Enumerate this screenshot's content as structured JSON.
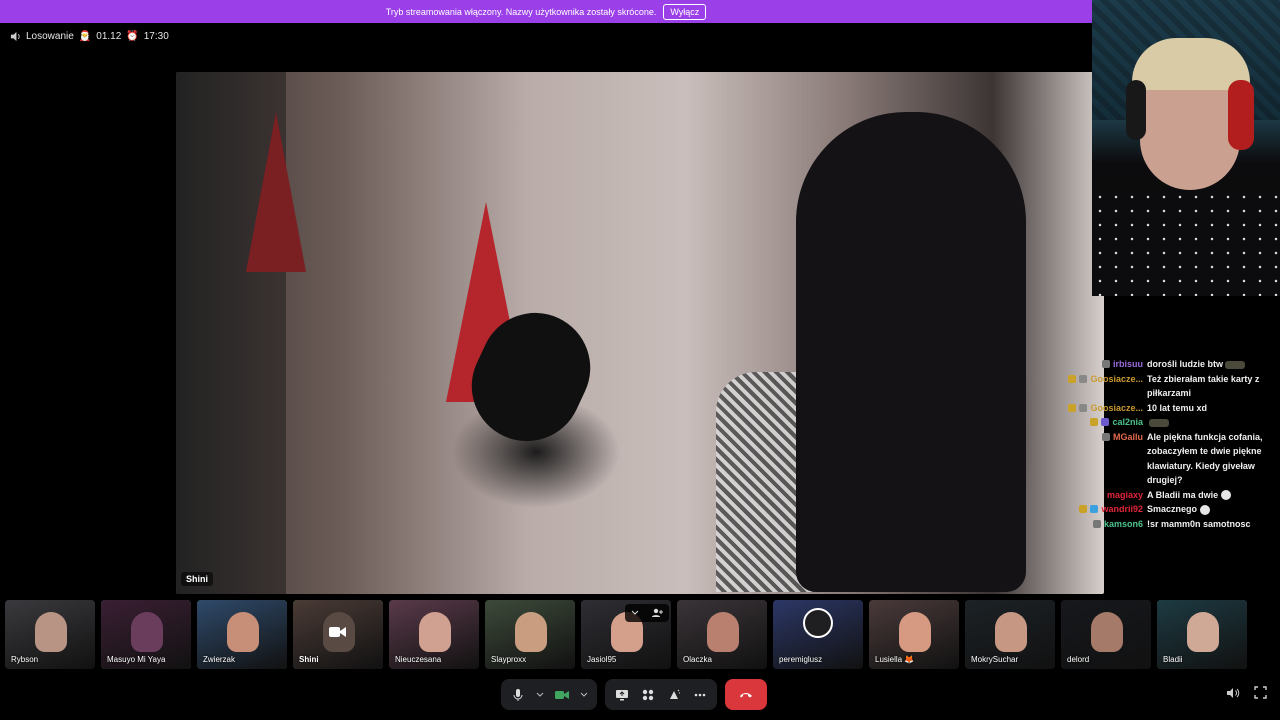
{
  "banner": {
    "message": "Tryb streamowania włączony. Nazwy użytkownika zostały skrócone.",
    "button": "Wyłącz"
  },
  "event": {
    "title": "Losowanie",
    "date_emoji": "🎅",
    "date": "01.12",
    "time_emoji": "⏰",
    "time": "17:30"
  },
  "stage": {
    "label": "Shini"
  },
  "chat": {
    "messages": [
      {
        "user": "irbisuu",
        "user_color": "#9b6bdc",
        "text": "dorośli ludzie btw",
        "emote": true,
        "badges": [
          "#777"
        ]
      },
      {
        "user": "Goosiacze...",
        "user_color": "#c99a2e",
        "text": "Też zbierałam takie karty z piłkarzami",
        "emote": false,
        "badges": [
          "#c9a227",
          "#888"
        ]
      },
      {
        "user": "Goosiacze...",
        "user_color": "#c99a2e",
        "text": "10 lat temu xd",
        "emote": false,
        "badges": [
          "#c9a227",
          "#888"
        ]
      },
      {
        "user": "cal2nia",
        "user_color": "#4cc28b",
        "text": "",
        "emote": true,
        "badges": [
          "#c9a227",
          "#6a5acd"
        ]
      },
      {
        "user": "MGallu",
        "user_color": "#e06a4c",
        "text": "Ale piękna funkcja cofania, zobaczyłem te dwie piękne klawiatury. Kiedy giveław drugiej?",
        "emote": false,
        "badges": [
          "#777"
        ]
      },
      {
        "user": "magiaxy",
        "user_color": "#e0263a",
        "text": "A Bladii ma dwie",
        "emote": false,
        "face": true,
        "badges": []
      },
      {
        "user": "wandrii92",
        "user_color": "#e0263a",
        "text": "Smacznego",
        "emote": false,
        "face": true,
        "badges": [
          "#c9a227",
          "#3aa0e0"
        ]
      },
      {
        "user": "kamson6",
        "user_color": "#4cc28b",
        "text": "!sr mamm0n samotnosc",
        "emote": false,
        "badges": [
          "#777"
        ]
      }
    ]
  },
  "participants": [
    {
      "name": "Rybson",
      "bg": "#3a3a3e",
      "skin": "#b89484",
      "speaking": false
    },
    {
      "name": "Masuyo Mi Yaya",
      "bg": "#3a1f33",
      "skin": "#6b3d5d",
      "speaking": true
    },
    {
      "name": "Zwierzak",
      "bg": "#2f4a6a",
      "skin": "#c78f78",
      "speaking": true
    },
    {
      "name": "Shini",
      "bg": "#4a3b36",
      "skin": "#5a4a44",
      "speaking": true,
      "camera_icon": true
    },
    {
      "name": "Nieuczesana",
      "bg": "#5a3a4a",
      "skin": "#d0a090",
      "speaking": false
    },
    {
      "name": "Slayproxx",
      "bg": "#3d4a3a",
      "skin": "#c89d80",
      "speaking": false
    },
    {
      "name": "Jasiol95",
      "bg": "#2e2e34",
      "skin": "#d4a08c",
      "speaking": false,
      "popout": true
    },
    {
      "name": "Olaczka",
      "bg": "#3a3438",
      "skin": "#b98070",
      "speaking": false
    },
    {
      "name": "peremiglusz",
      "bg": "#2c3766",
      "skin": "#1f1f22",
      "speaking": false,
      "obs": true
    },
    {
      "name": "Lusiella 🦊",
      "bg": "#4a3a3a",
      "skin": "#d69a82",
      "speaking": false
    },
    {
      "name": "MokrySuchar",
      "bg": "#1c2226",
      "skin": "#c69883",
      "speaking": false
    },
    {
      "name": "delord",
      "bg": "#16181c",
      "skin": "#a57a68",
      "speaking": false
    },
    {
      "name": "Bladii",
      "bg": "#1d3a42",
      "skin": "#d0a896",
      "speaking": true
    }
  ],
  "icons": {
    "speaker": "speaker-icon",
    "mic": "microphone-icon",
    "camera": "camera-icon",
    "screenshare": "screen-share-icon",
    "activities": "activities-icon",
    "soundboard": "soundboard-icon",
    "more": "more-icon",
    "hangup": "hang-up-icon",
    "volume": "volume-icon",
    "fullscreen": "fullscreen-icon"
  },
  "colors": {
    "banner": "#9b3fe8",
    "speaking": "#3fa55f",
    "hangup": "#da373c",
    "control_bg": "#1e1f22"
  }
}
